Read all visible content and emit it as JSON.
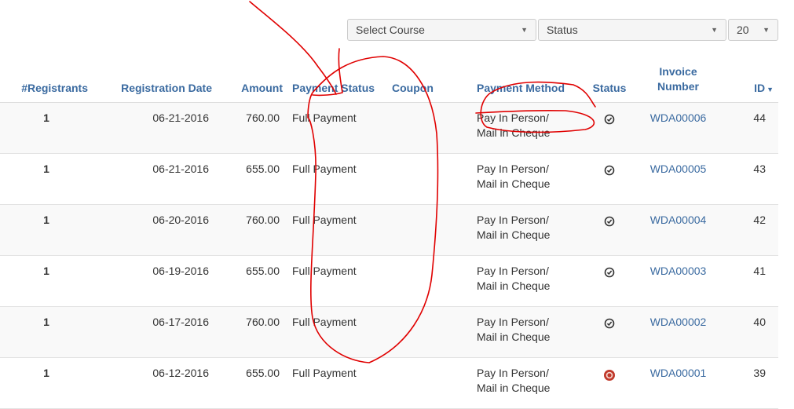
{
  "filters": {
    "course": {
      "value": "Select Course",
      "icon": "caret-down-icon"
    },
    "status": {
      "value": "Status",
      "icon": "caret-down-icon"
    },
    "page_size": {
      "value": "20",
      "icon": "caret-down-icon"
    }
  },
  "table": {
    "columns": {
      "registrants": "#Registrants",
      "registration_date": "Registration Date",
      "amount": "Amount",
      "payment_status": "Payment Status",
      "coupon": "Coupon",
      "payment_method": "Payment Method",
      "status": "Status",
      "invoice_line1": "Invoice",
      "invoice_line2": "Number",
      "id": "ID",
      "id_sort_icon": "sort-desc-caret-icon"
    },
    "rows": [
      {
        "registrants": "1",
        "date": "06-21-2016",
        "amount": "760.00",
        "payment_status": "Full Payment",
        "coupon": "",
        "method_line1": "Pay In Person/",
        "method_line2": "Mail in Cheque",
        "status_icon": "check-circle-icon",
        "invoice": "WDA00006",
        "id": "44"
      },
      {
        "registrants": "1",
        "date": "06-21-2016",
        "amount": "655.00",
        "payment_status": "Full Payment",
        "coupon": "",
        "method_line1": "Pay In Person/",
        "method_line2": "Mail in Cheque",
        "status_icon": "check-circle-icon",
        "invoice": "WDA00005",
        "id": "43"
      },
      {
        "registrants": "1",
        "date": "06-20-2016",
        "amount": "760.00",
        "payment_status": "Full Payment",
        "coupon": "",
        "method_line1": "Pay In Person/",
        "method_line2": "Mail in Cheque",
        "status_icon": "check-circle-icon",
        "invoice": "WDA00004",
        "id": "42"
      },
      {
        "registrants": "1",
        "date": "06-19-2016",
        "amount": "655.00",
        "payment_status": "Full Payment",
        "coupon": "",
        "method_line1": "Pay In Person/",
        "method_line2": "Mail in Cheque",
        "status_icon": "check-circle-icon",
        "invoice": "WDA00003",
        "id": "41"
      },
      {
        "registrants": "1",
        "date": "06-17-2016",
        "amount": "760.00",
        "payment_status": "Full Payment",
        "coupon": "",
        "method_line1": "Pay In Person/",
        "method_line2": "Mail in Cheque",
        "status_icon": "check-circle-icon",
        "invoice": "WDA00002",
        "id": "40"
      },
      {
        "registrants": "1",
        "date": "06-12-2016",
        "amount": "655.00",
        "payment_status": "Full Payment",
        "coupon": "",
        "method_line1": "Pay In Person/",
        "method_line2": "Mail in Cheque",
        "status_icon": "pending-circle-icon",
        "invoice": "WDA00001",
        "id": "39"
      }
    ]
  },
  "colors": {
    "link": "#3a6aa0",
    "status_ok": "#333333",
    "status_pending": "#c0392b",
    "annotation": "#e00000"
  }
}
